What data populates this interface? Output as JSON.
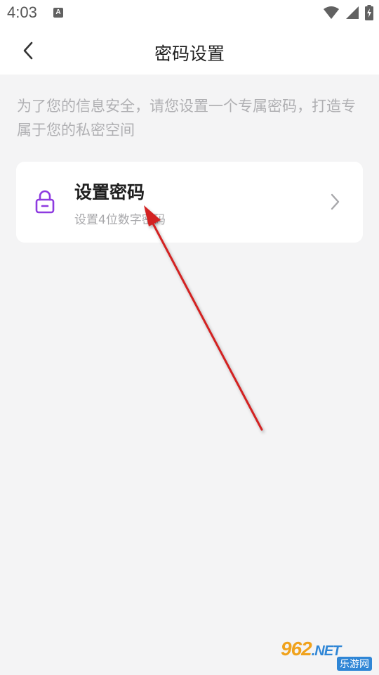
{
  "status_bar": {
    "time": "4:03",
    "notification_glyph": "A",
    "icons": [
      "wifi-icon",
      "signal-icon",
      "battery-charging-icon"
    ]
  },
  "header": {
    "title": "密码设置",
    "back_icon": "chevron-left-icon"
  },
  "intro": {
    "text": "为了您的信息安全，请您设置一个专属密码，打造专属于您的私密空间"
  },
  "card": {
    "icon": "lock-icon",
    "title": "设置密码",
    "subtitle": "设置4位数字密码",
    "chevron_icon": "chevron-right-icon"
  },
  "annotation": {
    "icon": "red-arrow-annotation"
  },
  "watermark": {
    "brand_number": "962",
    "brand_suffix": ".NET",
    "brand_cn": "乐游网"
  },
  "colors": {
    "background": "#f4f4f5",
    "surface": "#ffffff",
    "accent_purple": "#8e3ae0",
    "annotation_red": "#d32020",
    "text_primary": "#1f1f1f",
    "text_secondary": "#b0b0b3"
  }
}
